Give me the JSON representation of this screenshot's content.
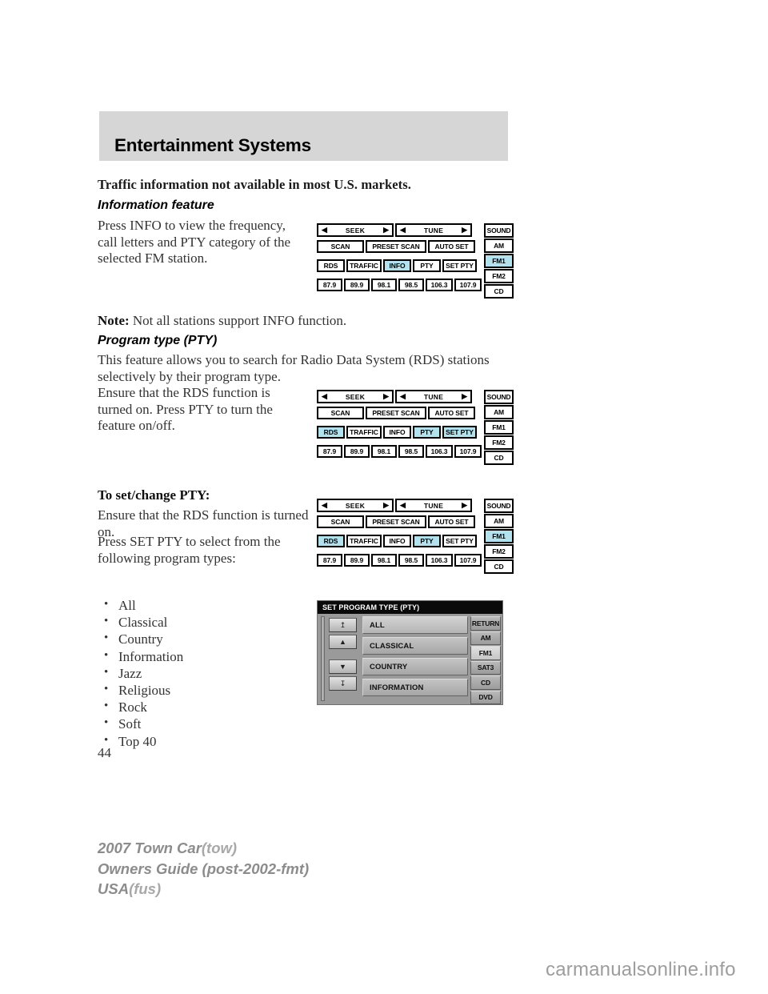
{
  "header": {
    "title": "Entertainment Systems"
  },
  "content": {
    "lede": "Traffic information not available in most U.S. markets.",
    "info_heading": "Information feature",
    "info_paragraph": "Press INFO to view the frequency, call letters and PTY category of the selected FM station.",
    "note_label": "Note:",
    "note_text": " Not all stations support INFO function.",
    "pty_heading": "Program type (PTY)",
    "pty_paragraph": "This feature allows you to search for Radio Data System (RDS) stations selectively by their program type.",
    "pty_paragraph2": "Ensure that the RDS function is turned on. Press PTY to turn the feature on/off.",
    "setchange_heading": "To set/change PTY:",
    "setchange_paragraph": "Ensure that the RDS function is turned on.",
    "setchange_paragraph2": "Press SET PTY to select from the following program types:",
    "program_types": [
      "All",
      "Classical",
      "Country",
      "Information",
      "Jazz",
      "Religious",
      "Rock",
      "Soft",
      "Top 40"
    ]
  },
  "panels": {
    "common": {
      "seek_label": "SEEK",
      "tune_label": "TUNE",
      "left_triangle": "◀",
      "right_triangle": "▶",
      "row2": [
        "SCAN",
        "PRESET SCAN",
        "AUTO SET"
      ],
      "row3": [
        "RDS",
        "TRAFFIC",
        "INFO",
        "PTY",
        "SET PTY"
      ],
      "presets": [
        "87.9",
        "89.9",
        "98.1",
        "98.5",
        "106.3",
        "107.9"
      ],
      "side_buttons": [
        "SOUND",
        "AM",
        "FM1",
        "FM2",
        "CD"
      ]
    },
    "panel1": {
      "highlighted_row3": [
        "INFO"
      ],
      "highlighted_side": [
        "FM1"
      ]
    },
    "panel2": {
      "highlighted_row3": [
        "RDS",
        "PTY",
        "SET PTY"
      ],
      "highlighted_side": []
    },
    "panel3": {
      "highlighted_row3": [
        "RDS",
        "PTY"
      ],
      "highlighted_side": [
        "FM1"
      ]
    }
  },
  "pty_screen": {
    "title": "SET PROGRAM TYPE (PTY)",
    "items": [
      "ALL",
      "CLASSICAL",
      "COUNTRY",
      "INFORMATION"
    ],
    "arrows": [
      "↥",
      "▲",
      "▼",
      "↧"
    ],
    "side_buttons": [
      "RETURN",
      "AM",
      "FM1",
      "SAT3",
      "CD",
      "DVD"
    ],
    "highlighted_side": [
      "FM1"
    ]
  },
  "footer": {
    "line1_bold": "2007 Town Car",
    "line1_light": "(tow)",
    "line2": "Owners Guide (post-2002-fmt)",
    "line3_bold": "USA",
    "line3_light": "(fus)"
  },
  "page_number": "44",
  "watermark": "carmanualsonline.info",
  "colors": {
    "highlight": "#b3e2ef",
    "header_bar": "#d6d6d6",
    "footer_text": "#8c8c8c"
  }
}
